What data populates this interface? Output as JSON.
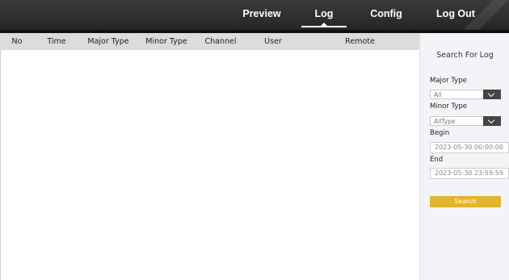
{
  "nav": {
    "items": [
      {
        "label": "Preview"
      },
      {
        "label": "Log",
        "active": true
      },
      {
        "label": "Config"
      },
      {
        "label": "Log Out"
      }
    ]
  },
  "log_table": {
    "columns": [
      "No",
      "Time",
      "Major Type",
      "Minor Type",
      "Channel",
      "User",
      "Remote"
    ],
    "rows": []
  },
  "search_panel": {
    "title": "Search For Log",
    "major_type_label": "Major Type",
    "major_type_value": "All",
    "minor_type_label": "Minor Type",
    "minor_type_value": "AllType",
    "begin_label": "Begin",
    "begin_value": "2023-05-30 00:00:00",
    "end_label": "End",
    "end_value": "2023-05-30 23:59:59",
    "search_button": "Search"
  },
  "colors": {
    "nav_bg": "#2e2e2e",
    "header_bg": "#dcdcdc",
    "panel_bg": "#f3f4f8",
    "accent": "#e1b52e"
  }
}
